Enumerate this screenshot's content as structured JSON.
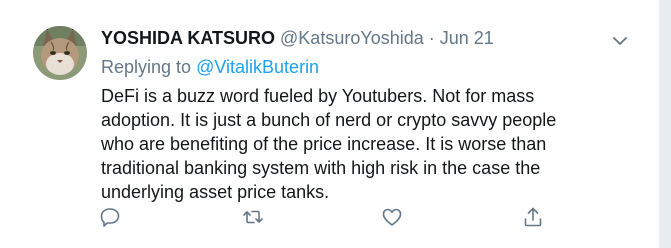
{
  "tweet": {
    "author_name": "YOSHIDA KATSURO",
    "author_handle": "@KatsuroYoshida",
    "separator": "·",
    "date": "Jun 21",
    "replying_to_label": "Replying to",
    "replying_to_handle": "@VitalikButerin",
    "body_lines": [
      "DeFi is a buzz word fueled by Youtubers. Not for mass",
      "adoption. It is just a bunch of nerd or crypto savvy people",
      "who are benefiting of the price increase. It is worse than",
      "traditional banking system with high risk in the case the",
      "underlying asset price tanks."
    ],
    "avatar_icon": "lynx-avatar",
    "actions": [
      "reply-icon",
      "retweet-icon",
      "like-icon",
      "share-icon"
    ]
  },
  "colors": {
    "text": "#14171a",
    "muted": "#657786",
    "accent": "#1da1f2",
    "background": "#e6ecf0"
  }
}
